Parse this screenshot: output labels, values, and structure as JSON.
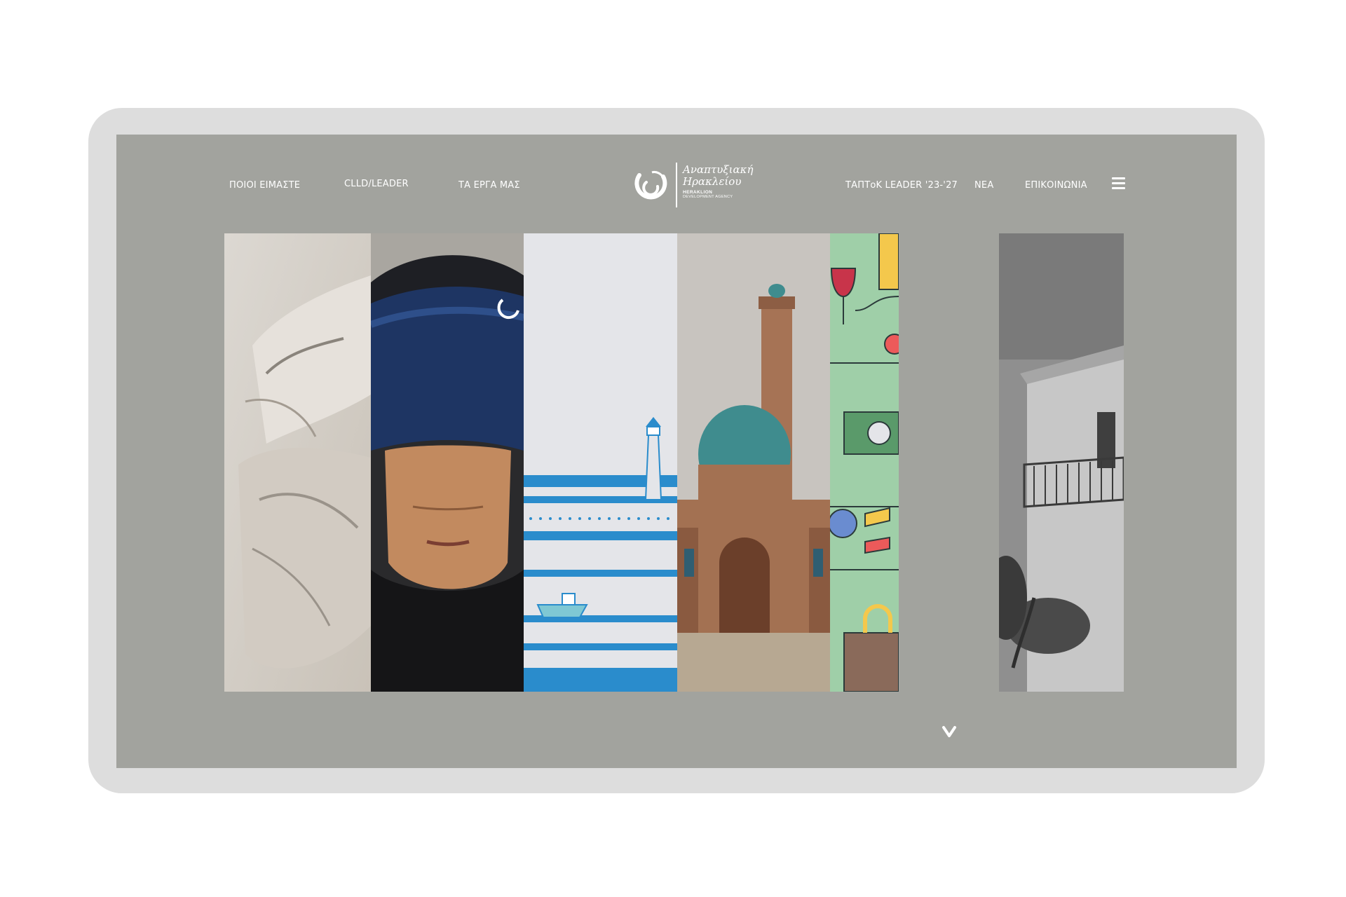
{
  "nav": {
    "left": [
      {
        "label": "ΠΟΙΟΙ ΕΙΜΑΣΤΕ"
      },
      {
        "label": "CLLD/LEADER"
      },
      {
        "label": "ΤΑ ΕΡΓΑ ΜΑΣ"
      }
    ],
    "right": [
      {
        "label": "ΤΑΠΤοΚ LEADER '23-'27"
      },
      {
        "label": "ΝΕΑ"
      },
      {
        "label": "ΕΠΙΚΟΙΝΩΝΙΑ"
      }
    ]
  },
  "logo": {
    "line1": "Αναπτυξιακή",
    "line2": "Ηρακλείου",
    "line3": "HERAKLION",
    "line4": "DEVELOPMENT AGENCY"
  },
  "icons": {
    "menu": "hamburger-menu-icon",
    "scroll": "chevron-down-icon",
    "logo_mark": "agency-logo-mark-icon"
  },
  "colors": {
    "background": "#a2a39e",
    "frame": "#dddddd",
    "text": "#ffffff",
    "accent_blue": "#2a8ccc",
    "accent_green": "#9fcfa8"
  },
  "panels": [
    {
      "id": "hands"
    },
    {
      "id": "girl-headband"
    },
    {
      "id": "lighthouse-illustration"
    },
    {
      "id": "mosque"
    },
    {
      "id": "icons-illustration"
    },
    {
      "id": "house-balcony"
    }
  ]
}
